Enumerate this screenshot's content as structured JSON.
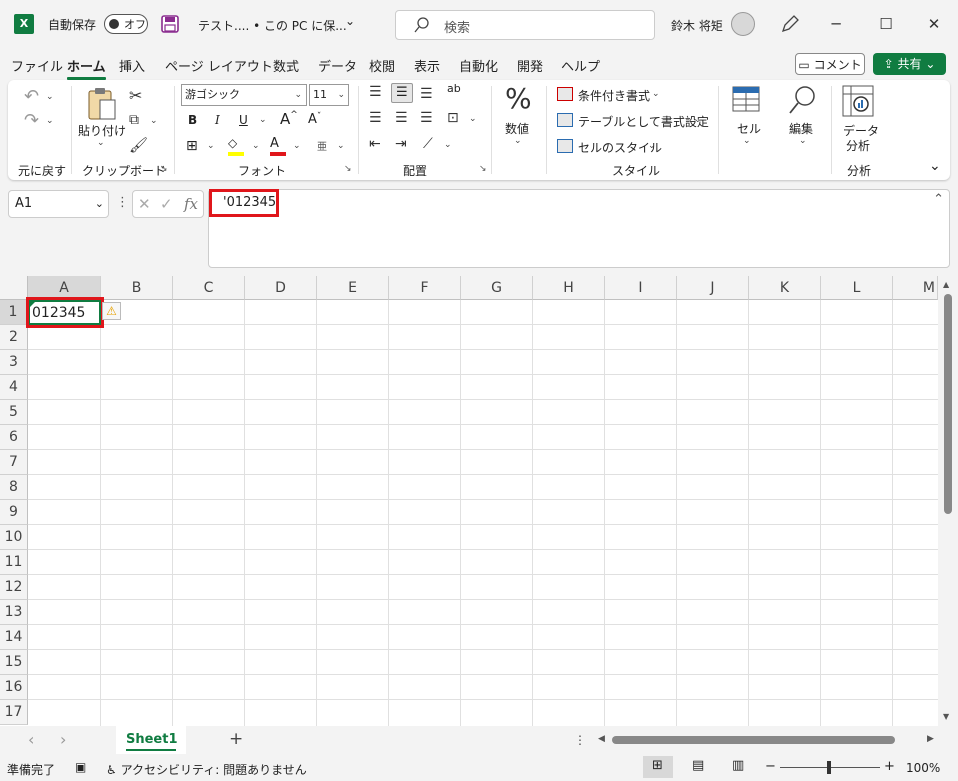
{
  "titlebar": {
    "app_icon": "X",
    "autosave_label": "自動保存",
    "autosave_state": "オフ",
    "doc_title": "テスト.... • この PC に保...",
    "search_placeholder": "検索",
    "user_name": "鈴木 将矩",
    "minimize": "─",
    "maximize": "☐",
    "close": "✕"
  },
  "menu": {
    "tabs": [
      "ファイル",
      "ホーム",
      "挿入",
      "ページ レイアウト",
      "数式",
      "データ",
      "校閲",
      "表示",
      "自動化",
      "開発",
      "ヘルプ"
    ],
    "active_tab": "ホーム",
    "comment_label": "コメント",
    "share_label": "共有"
  },
  "ribbon": {
    "undo_group": "元に戻す",
    "clipboard_group": "クリップボード",
    "paste_label": "貼り付け",
    "font_group": "フォント",
    "font_name": "游ゴシック",
    "font_size": "11",
    "bold": "B",
    "italic": "I",
    "underline": "U",
    "grow_font": "A",
    "shrink_font": "A",
    "font_color_letter": "A",
    "phonetic": "亜",
    "align_group": "配置",
    "wrap_label": "ab",
    "number_label": "数値",
    "percent_symbol": "%",
    "styles_group": "スタイル",
    "cond_format": "条件付き書式",
    "table_format": "テーブルとして書式設定",
    "cell_styles": "セルのスタイル",
    "cells_label": "セル",
    "edit_label": "編集",
    "analyze_label_1": "データ",
    "analyze_label_2": "分析",
    "analysis_group": "分析",
    "accent_color": "#107c41",
    "font_color_bar": "#e0161b",
    "highlight_color_bar": "#ffff00"
  },
  "formula_bar": {
    "name_box": "A1",
    "fx_label": "fx",
    "cancel": "✕",
    "enter": "✓",
    "content": "'012345"
  },
  "grid": {
    "columns": [
      "A",
      "B",
      "C",
      "D",
      "E",
      "F",
      "G",
      "H",
      "I",
      "J",
      "K",
      "L",
      "M"
    ],
    "rows": [
      "1",
      "2",
      "3",
      "4",
      "5",
      "6",
      "7",
      "8",
      "9",
      "10",
      "11",
      "12",
      "13",
      "14",
      "15",
      "16",
      "17"
    ],
    "a1_value": "012345",
    "warning_icon": "⚠",
    "highlight_color": "#e0161b"
  },
  "sheets": {
    "tabs": [
      "Sheet1"
    ],
    "add_label": "+",
    "prev": "‹",
    "next": "›",
    "more": "⋮"
  },
  "status": {
    "ready": "準備完了",
    "accessibility": "アクセシビリティ: 問題ありません",
    "zoom": "100%",
    "zoom_minus": "−",
    "zoom_plus": "+"
  }
}
